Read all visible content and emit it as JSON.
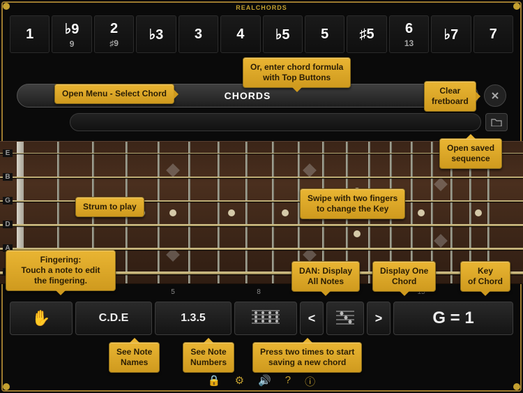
{
  "app_title": "REALCHORDS",
  "top_buttons": [
    {
      "main": "1",
      "sub": ""
    },
    {
      "main": "♭9",
      "sub": "9"
    },
    {
      "main": "2",
      "sub": "♯9"
    },
    {
      "main": "♭3",
      "sub": ""
    },
    {
      "main": "3",
      "sub": ""
    },
    {
      "main": "4",
      "sub": ""
    },
    {
      "main": "♭5",
      "sub": ""
    },
    {
      "main": "5",
      "sub": ""
    },
    {
      "main": "♯5",
      "sub": ""
    },
    {
      "main": "6",
      "sub": "13"
    },
    {
      "main": "♭7",
      "sub": ""
    },
    {
      "main": "7",
      "sub": ""
    }
  ],
  "chords_label": "CHORDS",
  "string_labels": [
    "E",
    "B",
    "G",
    "D",
    "A",
    "E"
  ],
  "fret_numbers": {
    "5": "5",
    "8": "8",
    "15": "15"
  },
  "bottom": {
    "hand": "✋",
    "cde": "C.D.E",
    "onethreefive": "1.3.5",
    "prev": "<",
    "next": ">",
    "key": "G = 1"
  },
  "tips": {
    "open_menu": "Open Menu - Select Chord",
    "formula": "Or, enter chord formula\nwith Top Buttons",
    "clear": "Clear\nfretboard",
    "open_saved": "Open saved\nsequence",
    "strum": "Strum to play",
    "swipe": "Swipe with two fingers\nto change the Key",
    "fingering": "Fingering:\nTouch a note to edit\nthe fingering.",
    "dan": "DAN: Display\nAll Notes",
    "display_one": "Display One\nChord",
    "key_of_chord": "Key\nof Chord",
    "see_names": "See Note\nNames",
    "see_numbers": "See Note\nNumbers",
    "press_twice": "Press two times to start\nsaving a new chord"
  }
}
